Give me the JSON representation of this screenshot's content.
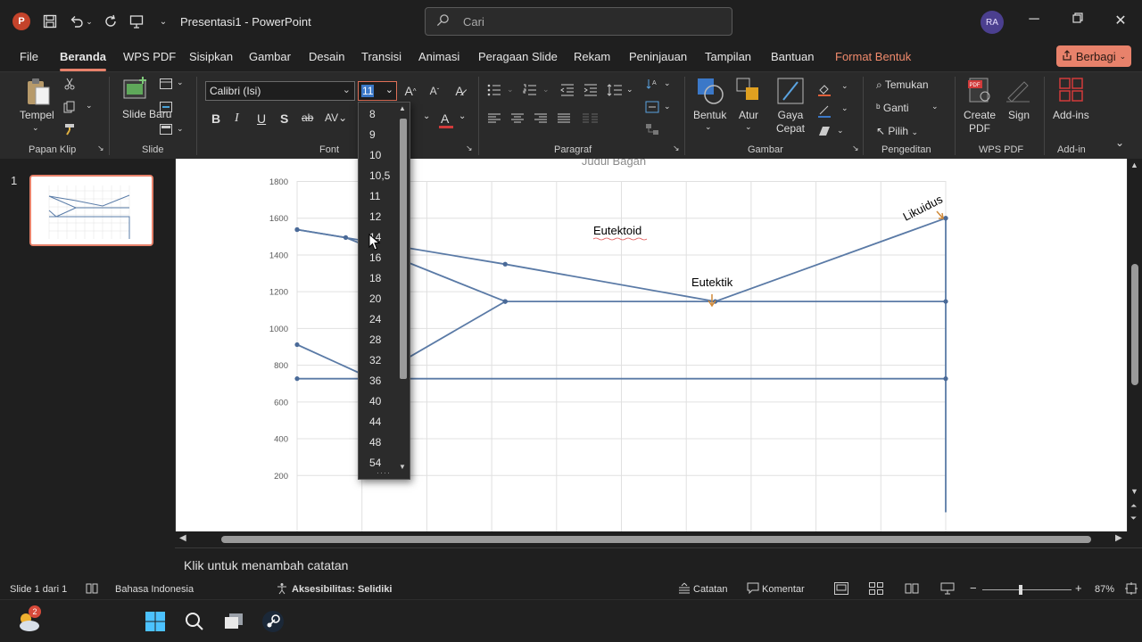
{
  "window": {
    "title": "Presentasi1  -  PowerPoint",
    "search_placeholder": "Cari",
    "user_initials": "RA"
  },
  "menu": {
    "tabs": [
      "File",
      "Beranda",
      "WPS PDF",
      "Sisipkan",
      "Gambar",
      "Desain",
      "Transisi",
      "Animasi",
      "Peragaan Slide",
      "Rekam",
      "Peninjauan",
      "Tampilan",
      "Bantuan",
      "Format Bentuk"
    ],
    "active": "Beranda",
    "share_label": "Berbagi"
  },
  "ribbon": {
    "paste_label": "Tempel",
    "clipboard_group": "Papan Klip",
    "new_slide_label": "Slide Baru",
    "slide_group": "Slide",
    "font_name": "Calibri (Isi)",
    "font_size": "11",
    "font_group": "Font",
    "paragraph_group": "Paragraf",
    "shape_label": "Bentuk",
    "arrange_label": "Atur",
    "quick_styles_label": "Gaya Cepat",
    "drawing_group": "Gambar",
    "find_label": "Temukan",
    "replace_label": "Ganti",
    "select_label": "Pilih",
    "editing_group": "Pengeditan",
    "create_pdf_label": "Create PDF",
    "sign_label": "Sign",
    "wps_group": "WPS PDF",
    "addins_label": "Add-ins",
    "addin_group": "Add-in",
    "pdf_badge": "PDF"
  },
  "font_size_dropdown": [
    "8",
    "9",
    "10",
    "10,5",
    "11",
    "12",
    "14",
    "16",
    "18",
    "20",
    "24",
    "28",
    "32",
    "36",
    "40",
    "44",
    "48",
    "54"
  ],
  "slides_panel": {
    "slide_number": "1"
  },
  "chart_data": {
    "type": "line",
    "title": "Judul Bagan",
    "y_ticks": [
      200,
      400,
      600,
      800,
      1000,
      1200,
      1400,
      1600,
      1800
    ],
    "ylim": [
      0,
      1800
    ],
    "grid": true,
    "annotations": [
      "Eutektoid",
      "Eutektik",
      "Likuidus"
    ],
    "series": [
      {
        "x": [
          0,
          2.14,
          4.3,
          6.67
        ],
        "y": [
          1538,
          1350,
          1147,
          1600
        ]
      },
      {
        "x": [
          0,
          0.5,
          2.14
        ],
        "y": [
          1538,
          1495,
          1147
        ]
      },
      {
        "x": [
          0,
          0.77,
          2.14
        ],
        "y": [
          912,
          727,
          1147
        ]
      },
      {
        "x": [
          0,
          6.67
        ],
        "y": [
          727,
          727
        ]
      },
      {
        "x": [
          2.14,
          6.67
        ],
        "y": [
          1147,
          1147
        ]
      },
      {
        "x": [
          6.67,
          6.67
        ],
        "y": [
          1600,
          0
        ]
      }
    ]
  },
  "notes": {
    "placeholder": "Klik untuk menambah catatan"
  },
  "status": {
    "slide_info": "Slide 1 dari 1",
    "language": "Bahasa Indonesia",
    "accessibility": "Aksesibilitas: Selidiki",
    "notes_label": "Catatan",
    "comments_label": "Komentar",
    "zoom": "87%"
  },
  "taskbar": {
    "weather_badge": "2"
  }
}
